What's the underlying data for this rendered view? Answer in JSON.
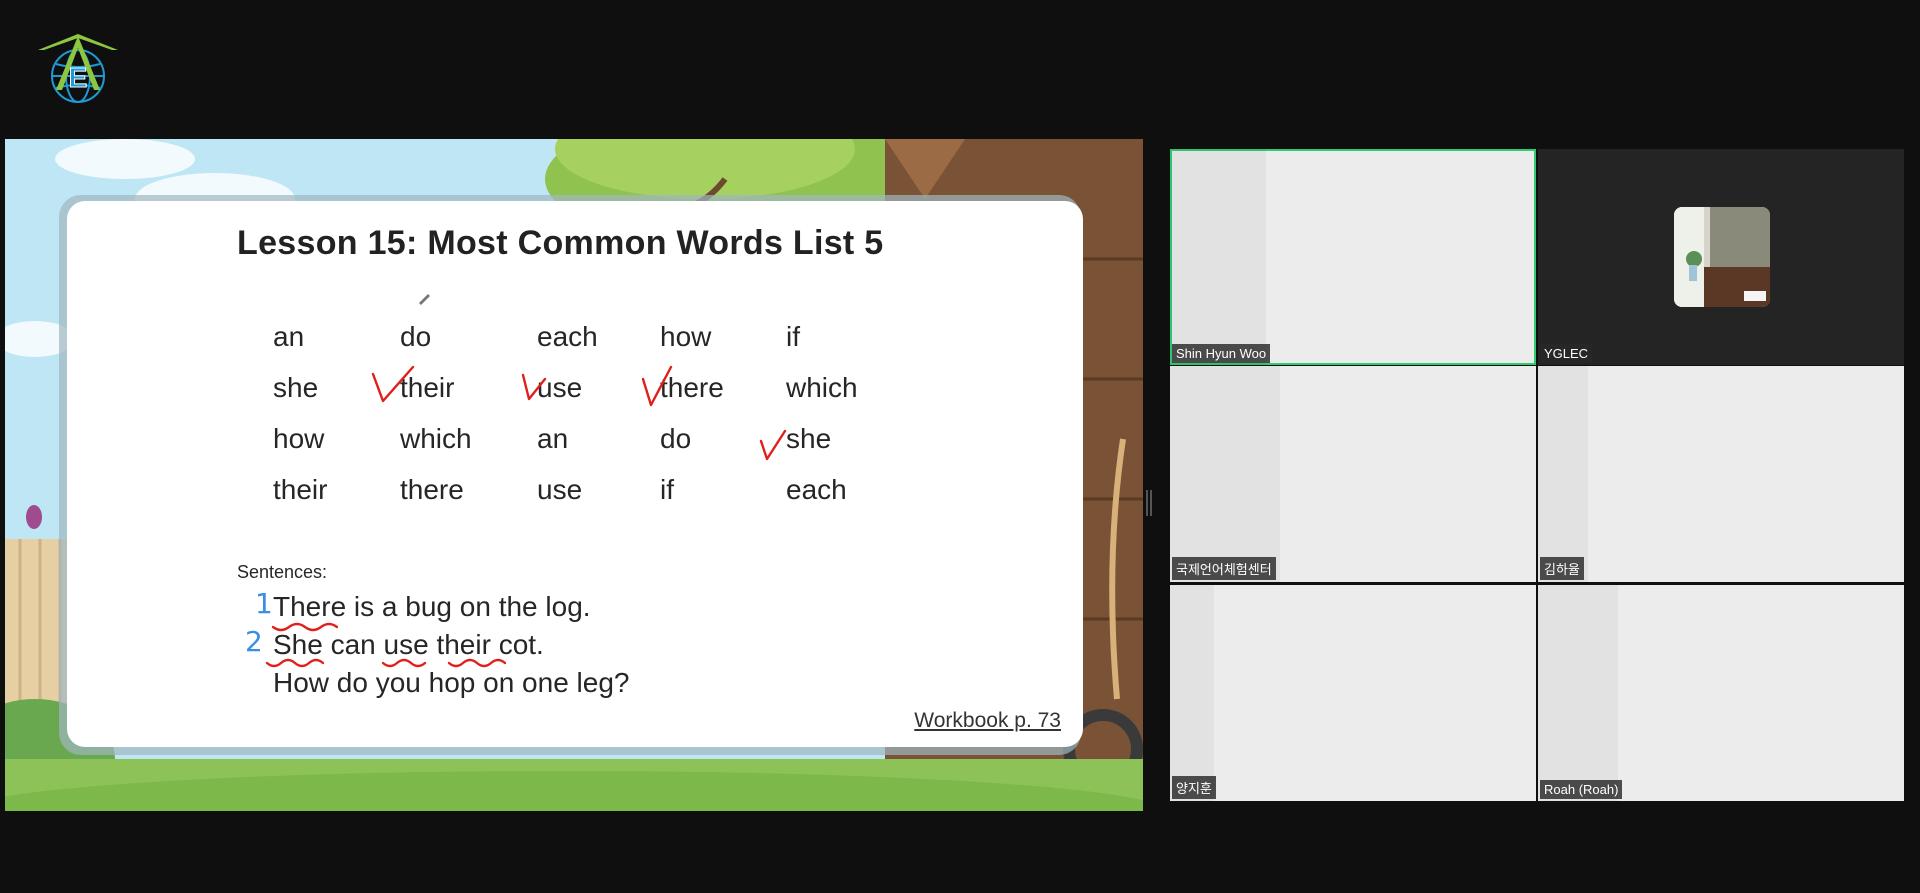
{
  "logo_letter": "E",
  "slide": {
    "title": "Lesson 15: Most Common Words List 5",
    "words": [
      [
        "an",
        "do",
        "each",
        "how",
        "if"
      ],
      [
        "she",
        "their",
        "use",
        "there",
        "which"
      ],
      [
        "how",
        "which",
        "an",
        "do",
        "she"
      ],
      [
        "their",
        "there",
        "use",
        "if",
        "each"
      ]
    ],
    "sentences_label": "Sentences:",
    "sentence_numbers": [
      "1",
      "2"
    ],
    "sentences": [
      "There is a bug on the log.",
      "She can use their cot.",
      "How do you hop on one leg?"
    ],
    "workbook_ref": "Workbook p. 73"
  },
  "participants": [
    {
      "name": "Shin Hyun Woo",
      "active": true,
      "video": "blurred"
    },
    {
      "name": "YGLEC",
      "active": false,
      "video": "avatar"
    },
    {
      "name": "국제언어체험센터",
      "active": false,
      "video": "blurred"
    },
    {
      "name": "김하율",
      "active": false,
      "video": "blurred"
    },
    {
      "name": "양지훈",
      "active": false,
      "video": "blurred"
    },
    {
      "name": "Roah (Roah)",
      "active": false,
      "video": "blurred"
    }
  ],
  "colors": {
    "background": "#0f0f0f",
    "active_speaker": "#2ecc71",
    "annotation_red": "#e0201c",
    "annotation_blue": "#3a8ee6",
    "logo_green": "#8dc63f",
    "logo_blue": "#1e9ad6"
  }
}
